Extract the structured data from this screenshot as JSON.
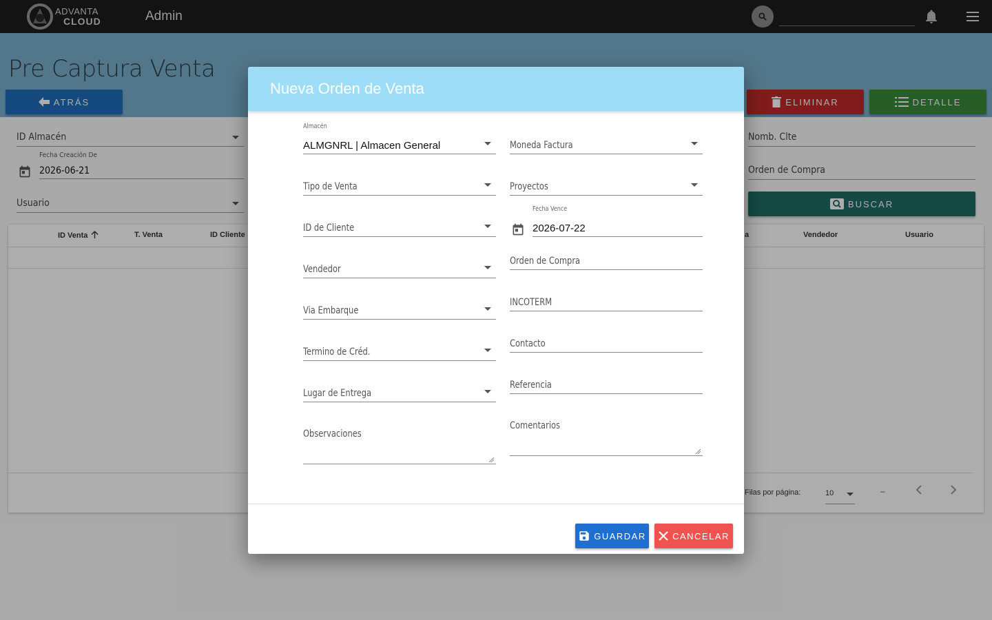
{
  "topbar": {
    "logo_line1": "ADVANTA",
    "logo_line2": "CLOUD",
    "title": "Admin",
    "search_value": ""
  },
  "page": {
    "title": "Pre Captura Venta",
    "back_label": "ATRÁS",
    "delete_label": "ELIMINAR",
    "detail_label": "DETALLE",
    "search_label": "BUSCAR"
  },
  "filters": {
    "almacen_label": "ID Almacén",
    "fecha_label": "Fecha Creación De",
    "fecha_value": "2026-06-21",
    "usuario_label": "Usuario",
    "nomb_clte_label": "Nomb. Clte",
    "orden_compra_label": "Orden de Compra"
  },
  "table": {
    "columns": [
      "ID Venta",
      "T. Venta",
      "ID Cliente",
      "a",
      "Vendedor",
      "Usuario"
    ],
    "sort_column": "ID Venta",
    "sort_direction": "asc",
    "rows_per_page_label": "Filas por página:",
    "rows_per_page": "10",
    "range": "–"
  },
  "dialog": {
    "title": "Nueva Orden de Venta",
    "almacen_label": "Almacén",
    "almacen_value": "ALMGNRL | Almacen General",
    "moneda_label": "Moneda Factura",
    "tipo_venta_label": "Tipo de Venta",
    "proyectos_label": "Proyectos",
    "id_cliente_label": "ID de Cliente",
    "fecha_vence_label": "Fecha Vence",
    "fecha_vence_value": "2026-07-22",
    "vendedor_label": "Vendedor",
    "orden_compra_label": "Orden de Compra",
    "via_embarque_label": "Via Embarque",
    "incoterm_label": "INCOTERM",
    "termino_cred_label": "Termino de Créd.",
    "contacto_label": "Contacto",
    "lugar_entrega_label": "Lugar de Entrega",
    "referencia_label": "Referencia",
    "observaciones_label": "Observaciones",
    "comentarios_label": "Comentarios",
    "save_label": "GUARDAR",
    "cancel_label": "CANCELAR"
  },
  "colors": {
    "topbar": "#1c1c1c",
    "header_band": "#7bb0cc",
    "back_button": "#1e6eb8",
    "delete_button": "#c02a2a",
    "detail_button": "#3a8a3a",
    "search_button": "#1f6e65",
    "dialog_header": "#9dddf8",
    "save_button": "#1f6fd0",
    "cancel_button": "#ef5350"
  }
}
